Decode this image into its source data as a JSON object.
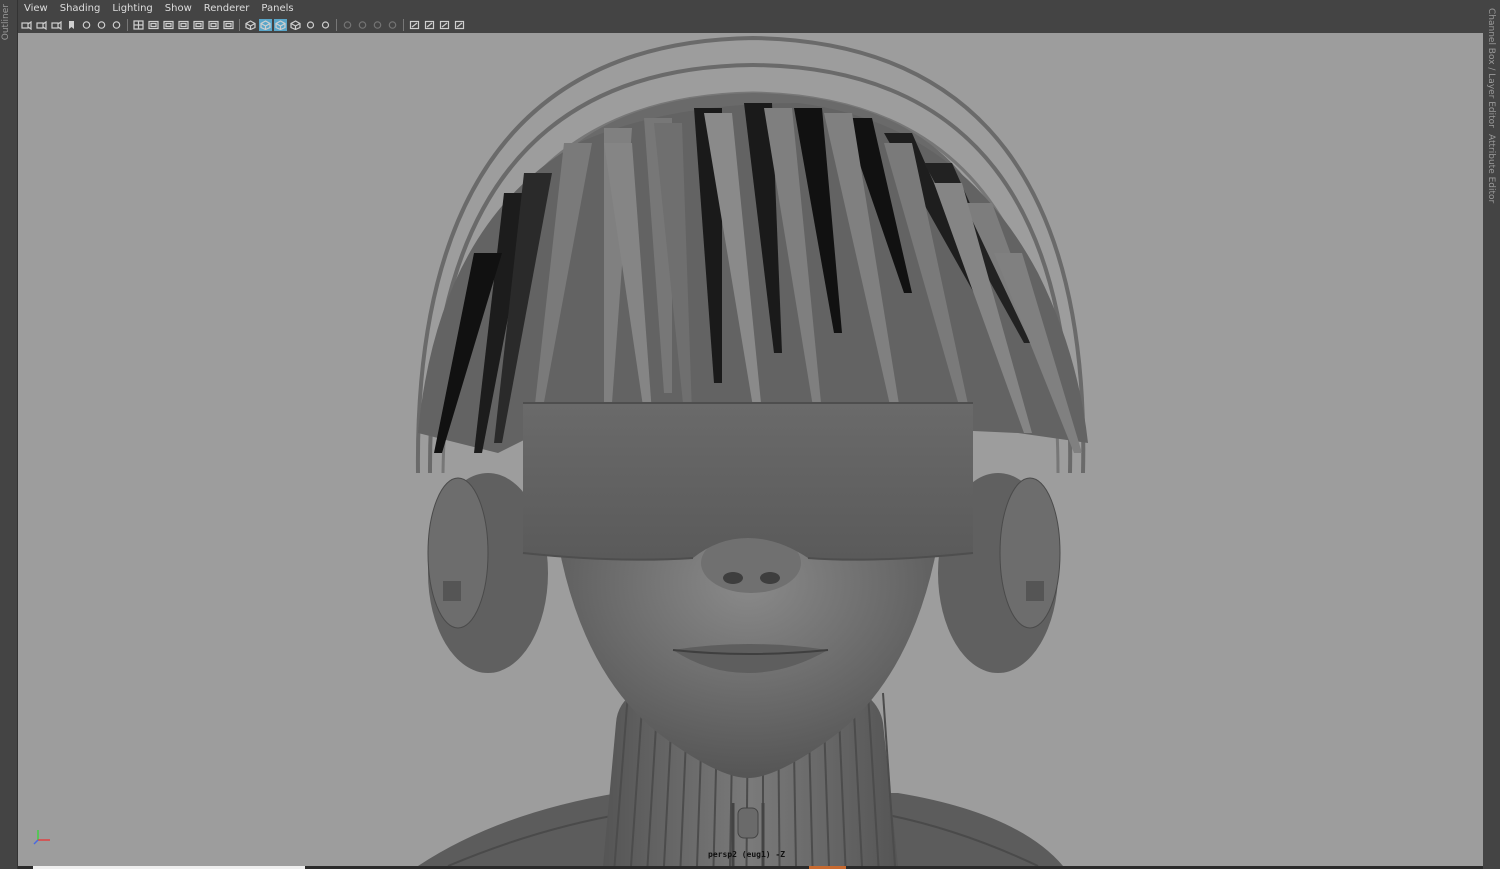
{
  "side_panels": {
    "left_label": "Outliner",
    "right_top_label": "Channel Box / Layer Editor",
    "right_bottom_label": "Attribute Editor"
  },
  "menu": {
    "items": [
      "View",
      "Shading",
      "Lighting",
      "Show",
      "Renderer",
      "Panels"
    ]
  },
  "toolbar": {
    "icons": [
      "camera-icon",
      "camera-attributes-icon",
      "camera-bookmark-icon",
      "bookmark-icon",
      "image-plane-icon",
      "2d-pan-zoom-icon",
      "grease-pencil-icon",
      "grid-icon",
      "film-gate-icon",
      "resolution-gate-icon",
      "gate-mask-icon",
      "field-chart-icon",
      "safe-action-icon",
      "safe-title-icon",
      "wireframe-icon",
      "smooth-shade-icon",
      "wireframe-on-shaded-icon",
      "textured-icon",
      "use-all-lights-icon",
      "shadows-icon",
      "screen-space-ao-icon",
      "motion-blur-icon",
      "multisample-aa-icon",
      "depth-of-field-icon",
      "isolate-select-icon",
      "xray-icon",
      "xray-joints-icon",
      "xray-components-icon"
    ],
    "active_icons": [
      "smooth-shade-icon",
      "wireframe-on-shaded-icon"
    ],
    "dim_icons": [
      "screen-space-ao-icon",
      "motion-blur-icon",
      "multisample-aa-icon",
      "depth-of-field-icon"
    ]
  },
  "viewport": {
    "camera_label": "persp2 (eug1) -Z",
    "background_color": "#9d9d9d",
    "axis_colors": {
      "x": "#e04040",
      "y": "#40d040",
      "z": "#4a6ae0"
    }
  },
  "timeline": {
    "progress_color": "#eeeeee",
    "marker_color": "#c86a30"
  }
}
